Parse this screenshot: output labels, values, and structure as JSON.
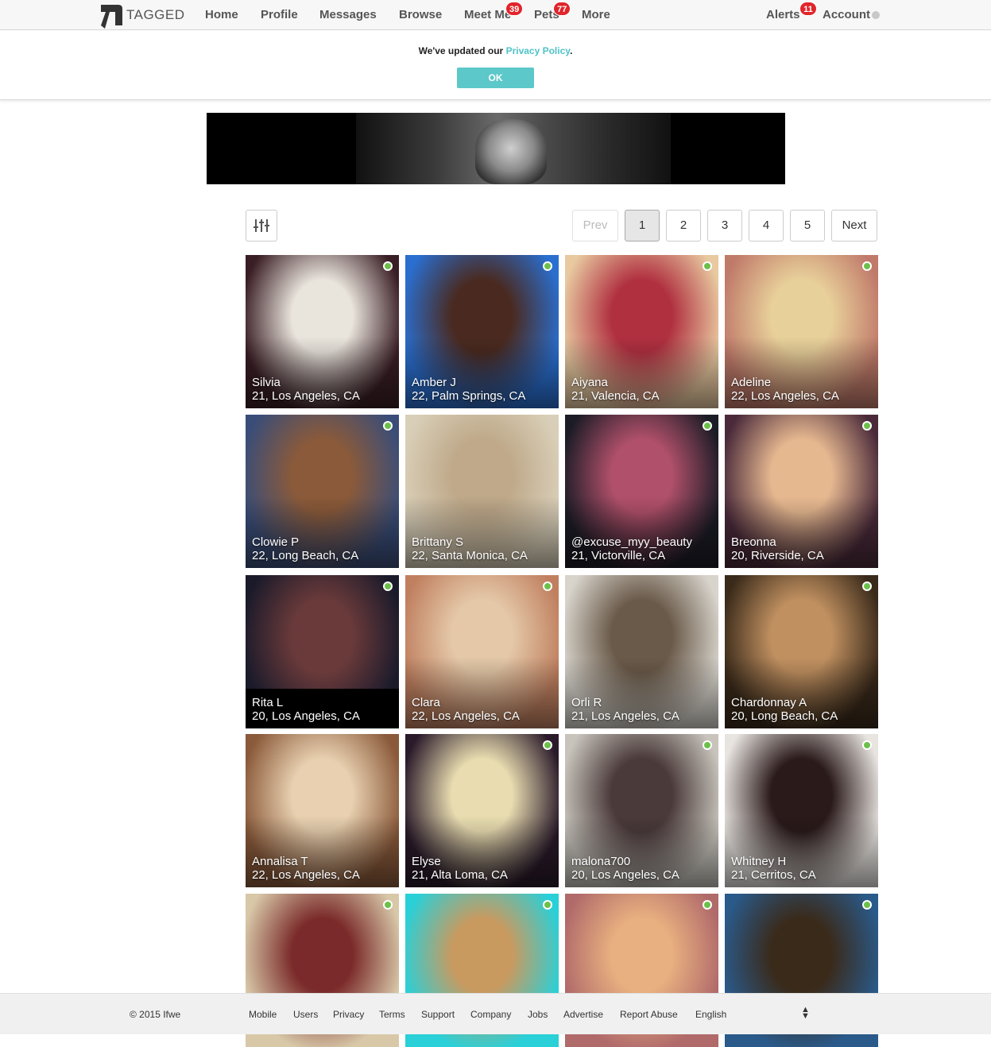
{
  "nav": {
    "logo_text": "TAGGED",
    "items": [
      {
        "label": "Home"
      },
      {
        "label": "Profile"
      },
      {
        "label": "Messages"
      },
      {
        "label": "Browse"
      },
      {
        "label": "Meet Me",
        "badge": "39"
      },
      {
        "label": "Pets",
        "badge": "77"
      },
      {
        "label": "More"
      }
    ],
    "alerts": {
      "label": "Alerts",
      "badge": "11"
    },
    "account": {
      "label": "Account"
    }
  },
  "privacy_banner": {
    "message_prefix": "We've updated our ",
    "link_text": "Privacy Policy",
    "message_suffix": ".",
    "ok_label": "OK"
  },
  "pagination": {
    "prev_label": "Prev",
    "pages": [
      "1",
      "2",
      "3",
      "4",
      "5"
    ],
    "current": "1",
    "next_label": "Next"
  },
  "profiles": [
    {
      "name": "Silvia",
      "location": "21, Los Angeles, CA",
      "online": true,
      "colors": [
        "#3a1e25",
        "#e9e4dc"
      ]
    },
    {
      "name": "Amber J",
      "location": "22, Palm Springs, CA",
      "online": true,
      "colors": [
        "#2a6fd0",
        "#4a2a20"
      ]
    },
    {
      "name": "Aiyana",
      "location": "21, Valencia, CA",
      "online": true,
      "colors": [
        "#e8c9a0",
        "#b03040"
      ]
    },
    {
      "name": "Adeline",
      "location": "22, Los Angeles, CA",
      "online": true,
      "colors": [
        "#c07a6a",
        "#e8d09a"
      ]
    },
    {
      "name": "Clowie P",
      "location": "22, Long Beach, CA",
      "online": true,
      "colors": [
        "#3a4d78",
        "#8a5a3a"
      ]
    },
    {
      "name": "Brittany S",
      "location": "22, Santa Monica, CA",
      "online": false,
      "colors": [
        "#d9cfb8",
        "#bfa98a"
      ]
    },
    {
      "name": "@excuse_myy_beauty",
      "location": "21, Victorville, CA",
      "online": true,
      "colors": [
        "#1c1c26",
        "#b0506a"
      ]
    },
    {
      "name": "Breonna",
      "location": "20, Riverside, CA",
      "online": true,
      "colors": [
        "#4a2a3a",
        "#e6b890"
      ]
    },
    {
      "name": "Rita L",
      "location": "20, Los Angeles, CA",
      "online": true,
      "colors": [
        "#1a1a2a",
        "#6a3a3a"
      ],
      "selected": true
    },
    {
      "name": "Clara",
      "location": "22, Los Angeles, CA",
      "online": true,
      "colors": [
        "#c08060",
        "#e4c8a8"
      ]
    },
    {
      "name": "Orli R",
      "location": "21, Los Angeles, CA",
      "online": false,
      "colors": [
        "#d8d4cc",
        "#6a5a4a"
      ]
    },
    {
      "name": "Chardonnay A",
      "location": "20, Long Beach, CA",
      "online": true,
      "colors": [
        "#3a2a1a",
        "#c09060"
      ]
    },
    {
      "name": "Annalisa T",
      "location": "22, Los Angeles, CA",
      "online": false,
      "colors": [
        "#8a5a3a",
        "#e8d0b0"
      ]
    },
    {
      "name": "Elyse",
      "location": "21, Alta Loma, CA",
      "online": true,
      "colors": [
        "#2a1a2a",
        "#e8dcb0"
      ]
    },
    {
      "name": "malona700",
      "location": "20, Los Angeles, CA",
      "online": true,
      "colors": [
        "#c8c4bc",
        "#4a3a3a"
      ]
    },
    {
      "name": "Whitney H",
      "location": "21, Cerritos, CA",
      "online": true,
      "colors": [
        "#e8e4e0",
        "#2a1a1a"
      ]
    },
    {
      "name": "",
      "location": "",
      "online": true,
      "colors": [
        "#d8c8a8",
        "#7a2a2a"
      ]
    },
    {
      "name": "",
      "location": "",
      "online": true,
      "colors": [
        "#2ad0d8",
        "#c89a60"
      ]
    },
    {
      "name": "",
      "location": "",
      "online": true,
      "colors": [
        "#b06a6a",
        "#e8b080"
      ]
    },
    {
      "name": "",
      "location": "",
      "online": true,
      "colors": [
        "#2a5a8a",
        "#3a2a1a"
      ]
    }
  ],
  "footer": {
    "copyright": "© 2015 Ifwe",
    "links": [
      "Mobile",
      "Users",
      "Privacy",
      "Terms",
      "Support",
      "Company",
      "Jobs",
      "Advertise",
      "Report Abuse"
    ],
    "language": "English"
  }
}
